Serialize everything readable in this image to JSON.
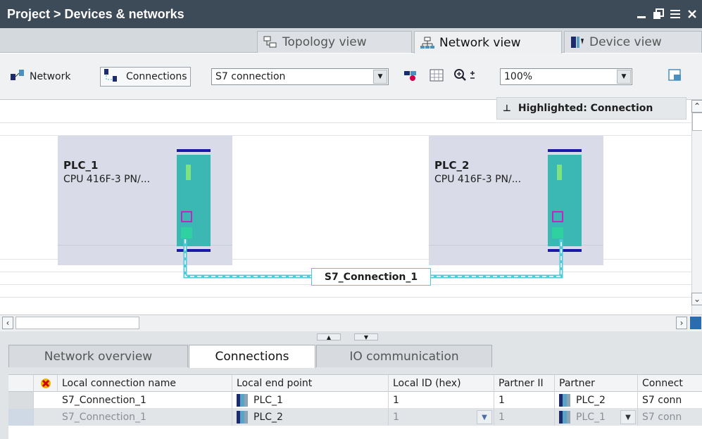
{
  "window": {
    "title": "Project > Devices & networks",
    "controls": [
      "minimize-icon",
      "float-icon",
      "maximize-icon",
      "close-icon"
    ]
  },
  "view_tabs": [
    {
      "label": "Topology view",
      "icon": "topology-icon",
      "active": false
    },
    {
      "label": "Network view",
      "icon": "network-icon",
      "active": true
    },
    {
      "label": "Device view",
      "icon": "device-icon",
      "active": false
    }
  ],
  "toolbar": {
    "network_label": "Network",
    "connections_label": "Connections",
    "connection_type": "S7 connection",
    "zoom": "100%",
    "highlighted": "Highlighted: Connection"
  },
  "devices": [
    {
      "name": "PLC_1",
      "type": "CPU 416F-3 PN/..."
    },
    {
      "name": "PLC_2",
      "type": "CPU 416F-3 PN/..."
    }
  ],
  "connection_label": "S7_Connection_1",
  "bottom_tabs": [
    {
      "label": "Network overview",
      "active": false
    },
    {
      "label": "Connections",
      "active": true
    },
    {
      "label": "IO communication",
      "active": false
    }
  ],
  "table": {
    "columns": [
      "Local connection name",
      "Local end point",
      "Local ID (hex)",
      "Partner II",
      "Partner",
      "Connect"
    ],
    "rows": [
      {
        "name": "S7_Connection_1",
        "local_end": "PLC_1",
        "local_id": "1",
        "partner_id": "1",
        "partner": "PLC_2",
        "type": "S7 conn"
      },
      {
        "name": "S7_Connection_1",
        "local_end": "PLC_2",
        "local_id": "1",
        "partner_id": "1",
        "partner": "PLC_1",
        "type": "S7 conn"
      }
    ]
  },
  "colors": {
    "titlebar": "#3d4a57",
    "module": "#3cb8b4",
    "bus": "#1a1aa8",
    "connection": "#52c9d9",
    "interface": "#c026c0"
  }
}
